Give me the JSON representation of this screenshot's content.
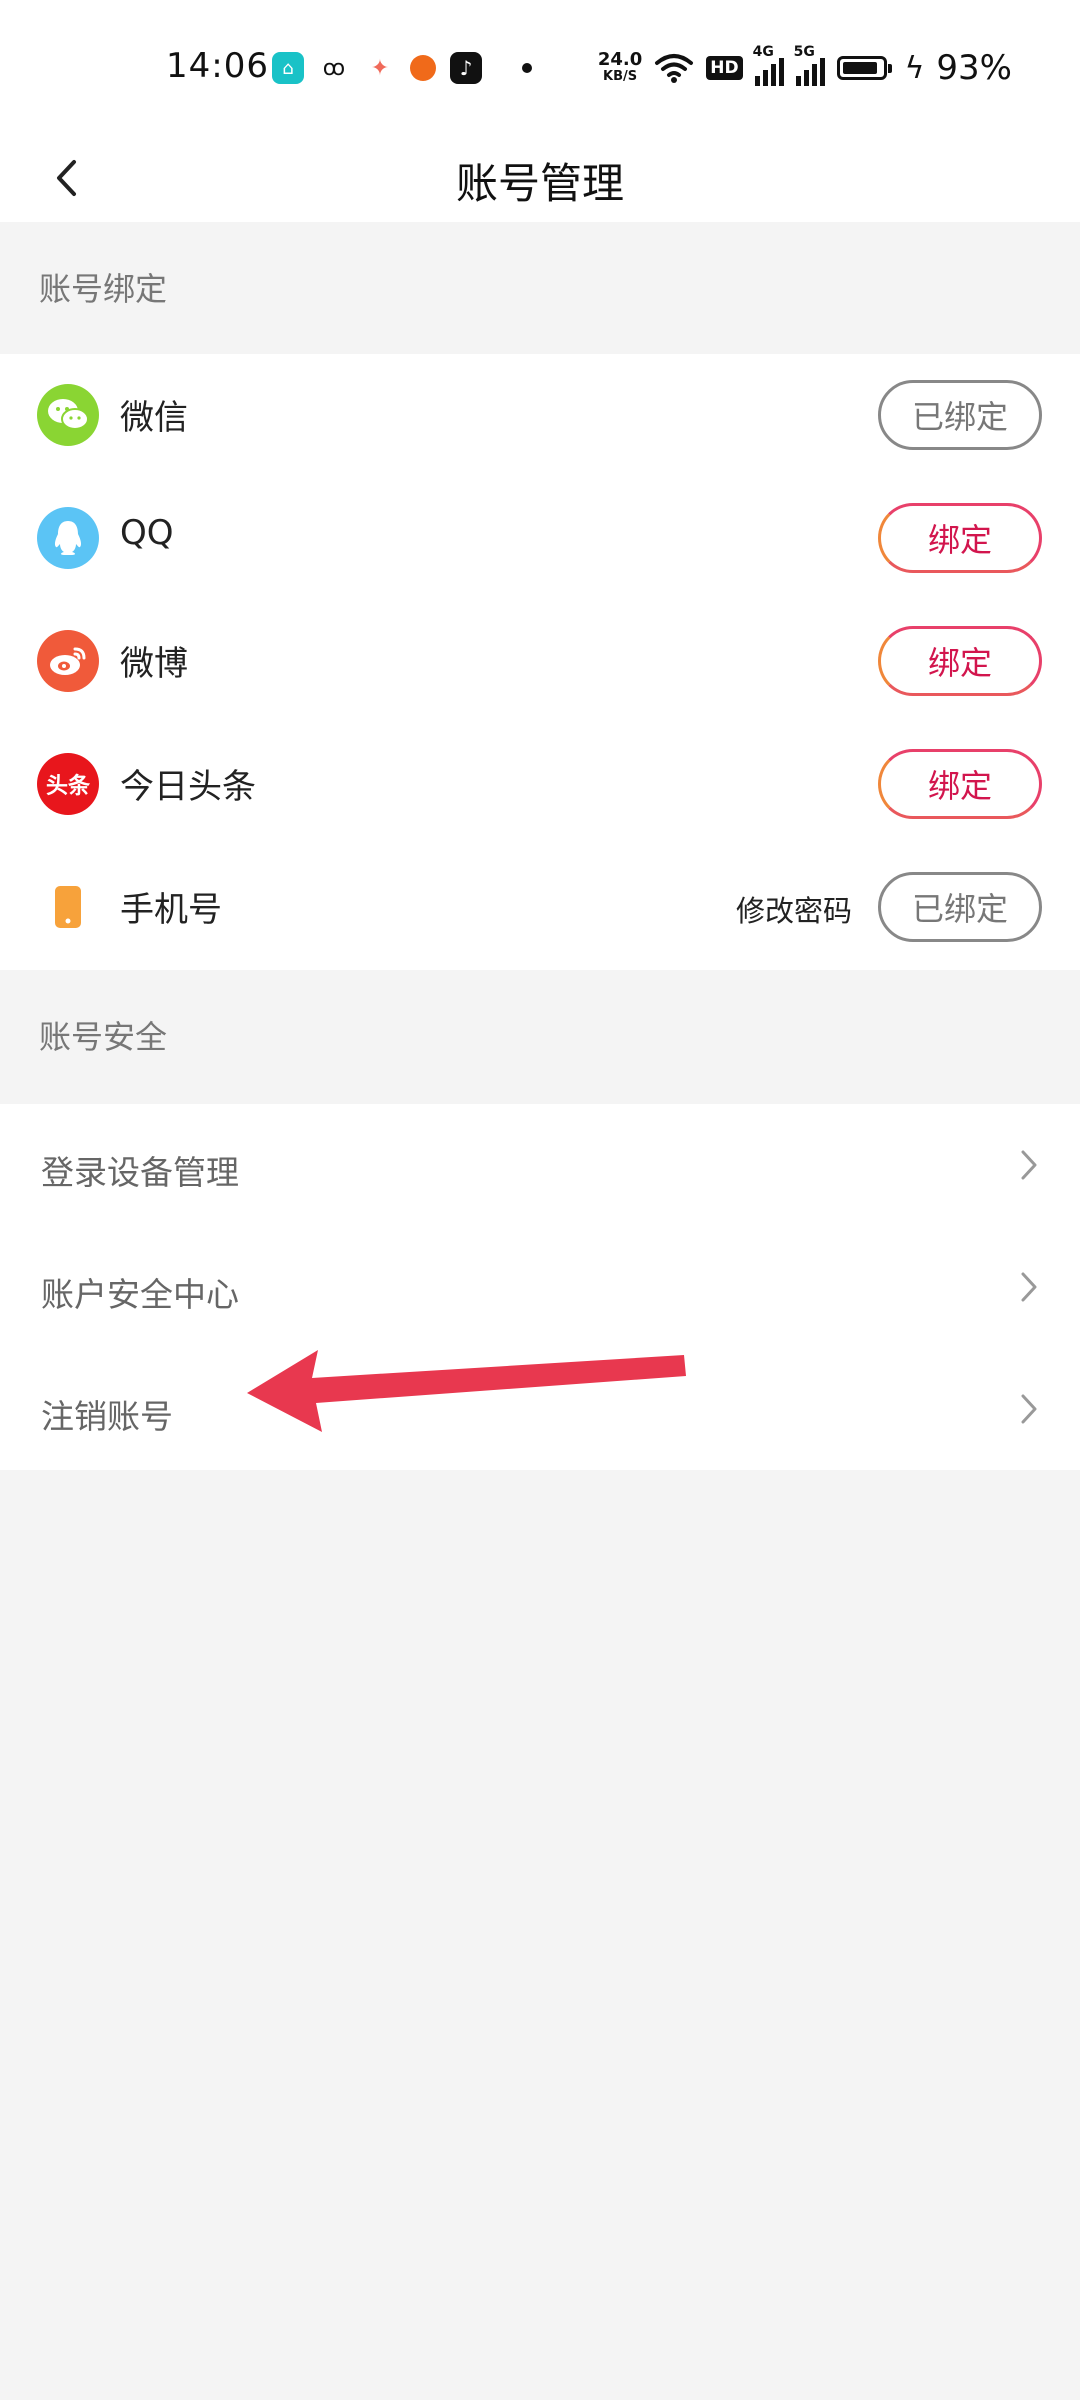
{
  "status_bar": {
    "time": "14:06",
    "speed_value": "24.0",
    "speed_unit": "KB/S",
    "hd": "HD",
    "signal_1": "4G",
    "signal_2": "5G",
    "battery": "93%",
    "app_icons": [
      "home-app-icon",
      "glasses-app-icon",
      "game-app-icon",
      "basketball-app-icon",
      "tiktok-app-icon"
    ]
  },
  "header": {
    "title": "账号管理"
  },
  "binding_section": {
    "title": "账号绑定",
    "items": [
      {
        "label": "微信",
        "icon": "wechat-icon",
        "color": "#8ad533",
        "status": "已绑定"
      },
      {
        "label": "QQ",
        "icon": "qq-icon",
        "color": "#5bc4f5",
        "status": "绑定"
      },
      {
        "label": "微博",
        "icon": "weibo-icon",
        "color": "#f05a3a",
        "status": "绑定"
      },
      {
        "label": "今日头条",
        "icon": "toutiao-icon",
        "icon_text": "头条",
        "color": "#e8161c",
        "status": "绑定"
      },
      {
        "label": "手机号",
        "icon": "phone-icon",
        "color": "#f7a23b",
        "status": "已绑定",
        "extra": "修改密码"
      }
    ]
  },
  "security_section": {
    "title": "账号安全",
    "items": [
      {
        "label": "登录设备管理"
      },
      {
        "label": "账户安全中心"
      },
      {
        "label": "注销账号"
      }
    ]
  },
  "colors": {
    "accent": "#d2154d",
    "annotation_arrow": "#e8384f",
    "background": "#f4f4f4"
  }
}
